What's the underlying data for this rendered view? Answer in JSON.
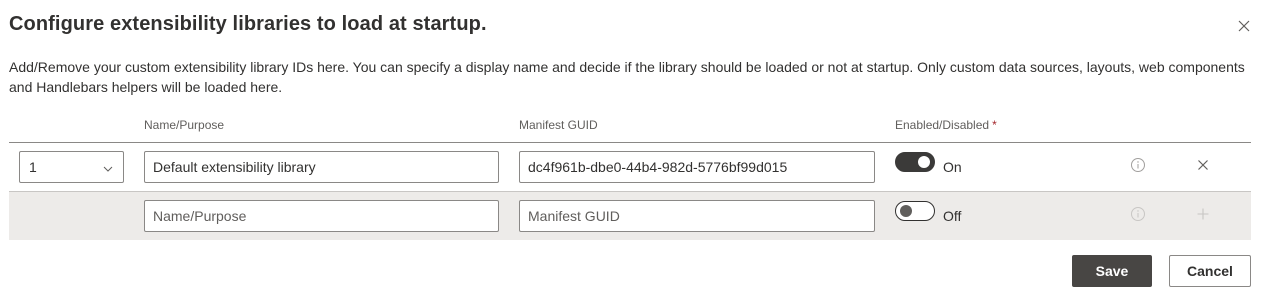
{
  "dialog": {
    "title": "Configure extensibility libraries to load at startup.",
    "description": "Add/Remove your custom extensibility library IDs here. You can specify a display name and decide if the library should be loaded or not at startup. Only custom data sources, layouts, web components and Handlebars helpers will be loaded here."
  },
  "table": {
    "headers": {
      "name": "Name/Purpose",
      "guid": "Manifest GUID",
      "enabled": "Enabled/Disabled",
      "required_marker": "*"
    },
    "rows": [
      {
        "order": "1",
        "name": "Default extensibility library",
        "guid": "dc4f961b-dbe0-44b4-982d-5776bf99d015",
        "enabled": true,
        "toggle_label": "On",
        "info_icon": "info-icon",
        "action_icon": "delete-icon"
      }
    ],
    "new_row": {
      "name_placeholder": "Name/Purpose",
      "guid_placeholder": "Manifest GUID",
      "enabled": false,
      "toggle_label": "Off",
      "info_icon": "info-icon",
      "action_icon": "add-icon"
    }
  },
  "footer": {
    "save_label": "Save",
    "cancel_label": "Cancel"
  },
  "colors": {
    "primary_button": "#484644",
    "toggle_on": "#3b3a39",
    "new_row_bg": "#edebe9",
    "required": "#a4262c"
  }
}
